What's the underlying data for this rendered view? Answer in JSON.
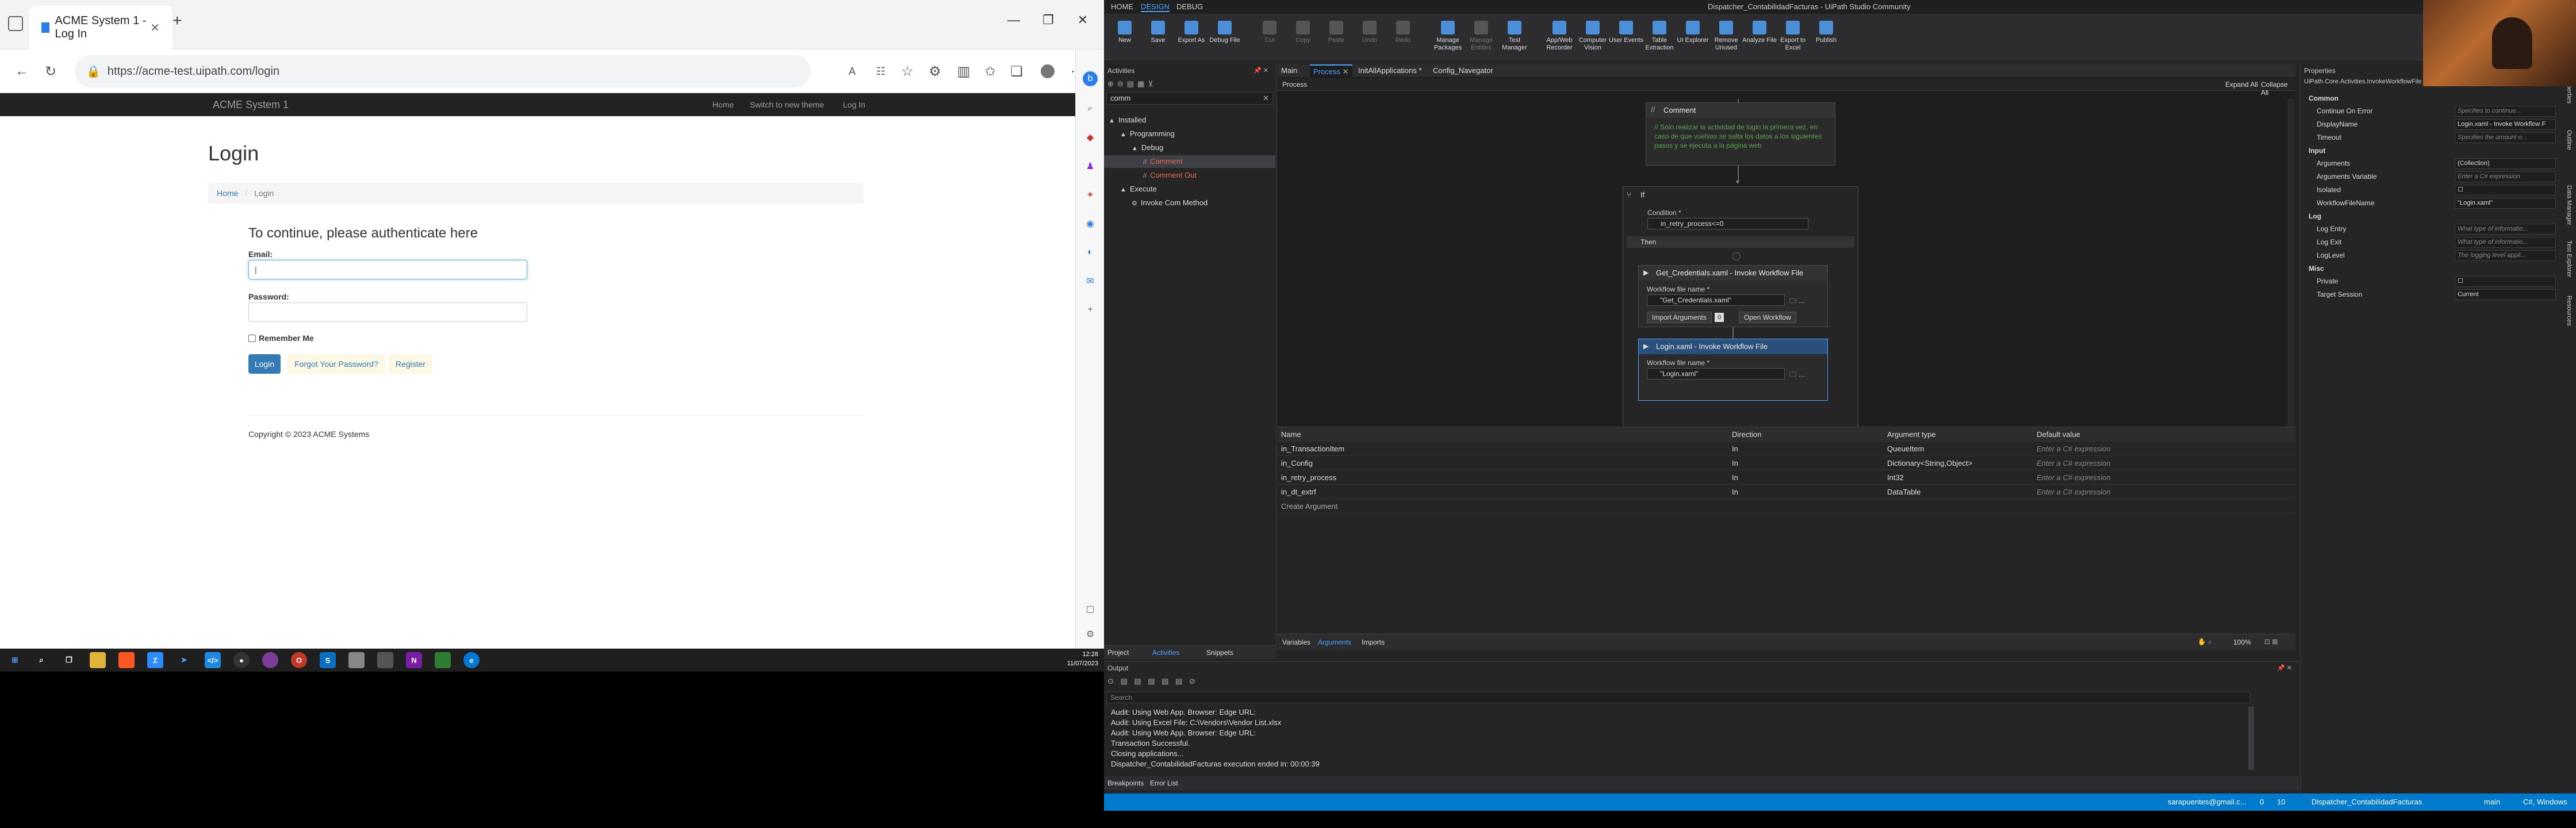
{
  "browser": {
    "tab_title": "ACME System 1 - Log In",
    "new_tab": "+",
    "url": "https://acme-test.uipath.com/login",
    "window_controls": [
      "—",
      "❐",
      "✕"
    ]
  },
  "acme": {
    "brand": "ACME System 1",
    "nav": [
      "Home",
      "Switch to new theme",
      "Log In"
    ],
    "page_title": "Login",
    "breadcrumb": [
      "Home",
      "Login"
    ],
    "form_heading": "To continue, please authenticate here",
    "email_label": "Email:",
    "email_value": "|",
    "password_label": "Password:",
    "remember_label": "Remember Me",
    "login_button": "Login",
    "forgot_link": "Forgot Your Password?",
    "register_link": "Register",
    "copyright": "Copyright © 2023 ACME Systems"
  },
  "taskbar": {
    "time": "12:28",
    "date": "11/07/2023"
  },
  "studio": {
    "window_title": "Dispatcher_ContabilidadFacturas - UiPath Studio Community",
    "menu": [
      "HOME",
      "DESIGN",
      "DEBUG"
    ],
    "ribbon": [
      {
        "label": "New",
        "dim": false
      },
      {
        "label": "Save",
        "dim": false
      },
      {
        "label": "Export As",
        "dim": false
      },
      {
        "label": "Debug File",
        "dim": false
      },
      {
        "label": "Cut",
        "dim": true
      },
      {
        "label": "Copy",
        "dim": true
      },
      {
        "label": "Paste",
        "dim": true
      },
      {
        "label": "Undo",
        "dim": true
      },
      {
        "label": "Redo",
        "dim": true
      },
      {
        "label": "Manage Packages",
        "dim": false
      },
      {
        "label": "Manage Entities",
        "dim": true
      },
      {
        "label": "Test Manager",
        "dim": false
      },
      {
        "label": "App/Web Recorder",
        "dim": false
      },
      {
        "label": "Computer Vision",
        "dim": false
      },
      {
        "label": "User Events",
        "dim": false
      },
      {
        "label": "Table Extraction",
        "dim": false
      },
      {
        "label": "UI Explorer",
        "dim": false
      },
      {
        "label": "Remove Unused",
        "dim": false
      },
      {
        "label": "Analyze File",
        "dim": false
      },
      {
        "label": "Export to Excel",
        "dim": false
      },
      {
        "label": "Publish",
        "dim": false
      }
    ],
    "activities": {
      "title": "Activities",
      "search": "comm",
      "tree": [
        {
          "label": "Installed",
          "level": 0,
          "prefix": "▲"
        },
        {
          "label": "Programming",
          "level": 1,
          "prefix": "▲"
        },
        {
          "label": "Debug",
          "level": 2,
          "prefix": "▲"
        },
        {
          "label": "Comment",
          "level": 3,
          "prefix": "//",
          "selected": true
        },
        {
          "label": "Comment Out",
          "level": 3,
          "prefix": "//"
        },
        {
          "label": "Execute",
          "level": 1,
          "prefix": "▲"
        },
        {
          "label": "Invoke Com Method",
          "level": 2,
          "prefix": "⚙"
        }
      ]
    },
    "doc_tabs": [
      "Main",
      "Process",
      "InitAllApplications *",
      "Config_Navegator"
    ],
    "breadcrumb": "Process",
    "expand_all": "Expand All",
    "collapse_all": "Collapse All",
    "comment": {
      "title": "Comment",
      "text": "// Solo realizar la actividad de login la primera vez, en caso de que vuelvas se salta los datos a los siguientes pasos y se ejecuta a la página web"
    },
    "if_block": {
      "title": "If",
      "condition_label": "Condition *",
      "condition": "in_retry_process<=0",
      "then_label": "Then"
    },
    "invoke1": {
      "title": "Get_Credentials.xaml - Invoke Workflow File",
      "file_label": "Workflow file name *",
      "file": "\"Get_Credentials.xaml\"",
      "import_btn": "Import Arguments",
      "import_count": "0",
      "open_btn": "Open Workflow"
    },
    "invoke2": {
      "title": "Login.xaml - Invoke Workflow File",
      "file_label": "Workflow file name *",
      "file": "\"Login.xaml\""
    },
    "args_table": {
      "headers": [
        "Name",
        "Direction",
        "Argument type",
        "Default value"
      ],
      "rows": [
        [
          "in_TransactionItem",
          "In",
          "QueueItem",
          "Enter a C# expression"
        ],
        [
          "in_Config",
          "In",
          "Dictionary<String,Object>",
          "Enter a C# expression"
        ],
        [
          "in_retry_process",
          "In",
          "Int32",
          "Enter a C# expression"
        ],
        [
          "in_dt_extrf",
          "In",
          "DataTable",
          "Enter a C# expression"
        ]
      ],
      "create": "Create Argument"
    },
    "bottom_tabs": [
      "Variables",
      "Arguments",
      "Imports"
    ],
    "zoom": "100%",
    "left_bottom_tabs": [
      "Project",
      "Activities",
      "Snippets"
    ],
    "properties": {
      "title": "Properties",
      "subtitle": "UiPath.Core.Activities.InvokeWorkflowFile",
      "sections": [
        {
          "name": "Common",
          "rows": [
            [
              "Continue On Error",
              "Specifies to continue...",
              true
            ],
            [
              "DisplayName",
              "Login.xaml - Invoke Workflow F",
              false
            ],
            [
              "Timeout",
              "Specifies the amount o...",
              true
            ]
          ]
        },
        {
          "name": "Input",
          "rows": [
            [
              "Arguments",
              "(Collection)",
              false
            ],
            [
              "Arguments Variable",
              "Enter a C# expression",
              true
            ],
            [
              "Isolated",
              "☐",
              false
            ],
            [
              "WorkflowFileName",
              "\"Login.xaml\"",
              false
            ]
          ]
        },
        {
          "name": "Log",
          "rows": [
            [
              "Log Entry",
              "What type of informatio...",
              true
            ],
            [
              "Log Exit",
              "What type of informatio...",
              true
            ],
            [
              "LogLevel",
              "The logging level appli...",
              true
            ]
          ]
        },
        {
          "name": "Misc",
          "rows": [
            [
              "Private",
              "☐",
              false
            ],
            [
              "Target Session",
              "Current",
              false
            ]
          ]
        }
      ]
    },
    "output": {
      "title": "Output",
      "search": "Search",
      "lines": [
        "Audit: Using Web App. Browser: Edge URL:",
        "Audit: Using Excel File: C:\\Vendors\\Vendor List.xlsx",
        "Audit: Using Web App. Browser: Edge URL:",
        "Transaction Successful.",
        "Closing applications...",
        "Dispatcher_ContabilidadFacturas execution ended in: 00:00:39"
      ]
    },
    "footer_tabs": [
      "Breakpoints",
      "Error List"
    ],
    "status": {
      "user": "sarapuentes@gmail.c...",
      "errors": "0",
      "warnings": "10",
      "project": "Dispatcher_ContabilidadFacturas",
      "branch": "main",
      "target": "C#, Windows"
    },
    "right_strip": [
      "Properties",
      "Outline",
      "Data Manager",
      "Test Explorer",
      "Resources"
    ]
  }
}
